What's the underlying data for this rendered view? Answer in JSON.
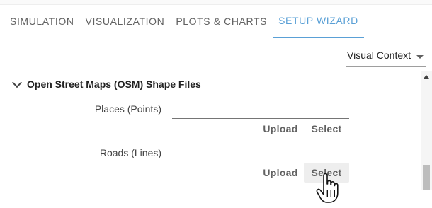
{
  "tabs": [
    {
      "label": "SIMULATION",
      "active": false
    },
    {
      "label": "VISUALIZATION",
      "active": false
    },
    {
      "label": "PLOTS & CHARTS",
      "active": false
    },
    {
      "label": "SETUP WIZARD",
      "active": true
    }
  ],
  "context_selector": {
    "value": "Visual Context"
  },
  "section": {
    "title": "Open Street Maps (OSM) Shape Files",
    "fields": [
      {
        "label": "Places (Points)",
        "value": "",
        "upload_label": "Upload",
        "select_label": "Select"
      },
      {
        "label": "Roads (Lines)",
        "value": "",
        "upload_label": "Upload",
        "select_label": "Select"
      }
    ]
  },
  "colors": {
    "accent": "#5aa0d6",
    "text": "#424242",
    "hover": "#eeeeee"
  }
}
